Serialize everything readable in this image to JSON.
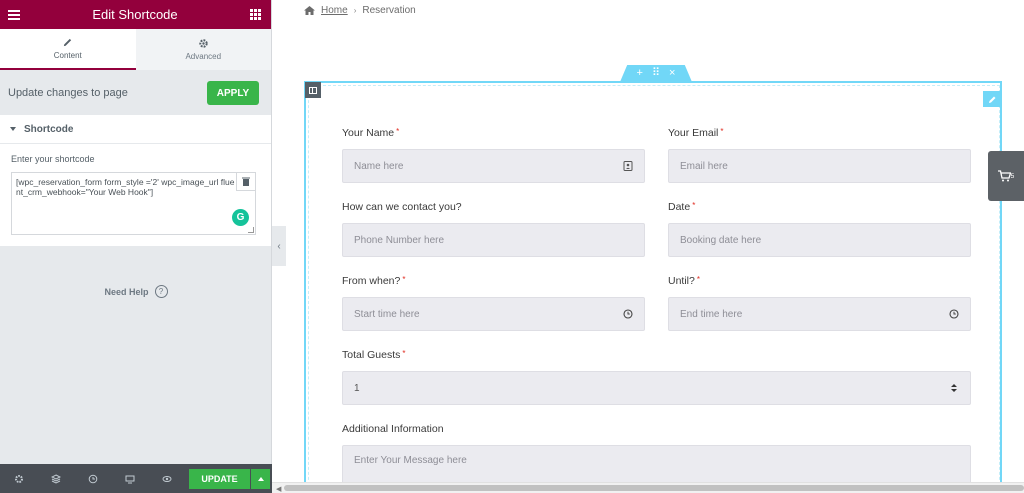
{
  "panel": {
    "title": "Edit Shortcode",
    "tabs": [
      {
        "label": "Content",
        "icon": "pencil-icon"
      },
      {
        "label": "Advanced",
        "icon": "gear-icon"
      }
    ],
    "apply_text": "Update changes to page",
    "apply_label": "APPLY",
    "section_title": "Shortcode",
    "field_label": "Enter your shortcode",
    "shortcode_value": "[wpc_reservation_form form_style ='2' wpc_image_url fluent_crm_webhook=\"Your Web Hook\"]",
    "need_help": "Need Help",
    "footer": {
      "update_label": "UPDATE",
      "icons": [
        "settings-icon",
        "layers-icon",
        "history-icon",
        "responsive-icon",
        "preview-eye-icon"
      ]
    },
    "colors": {
      "header": "#93003c",
      "apply": "#39b54a",
      "footer": "#484d54"
    }
  },
  "preview": {
    "breadcrumb": {
      "home": "Home",
      "current": "Reservation"
    },
    "form": {
      "name": {
        "label": "Your Name",
        "placeholder": "Name here"
      },
      "email": {
        "label": "Your Email",
        "placeholder": "Email here"
      },
      "contact": {
        "label": "How can we contact you?",
        "placeholder": "Phone Number here"
      },
      "date": {
        "label": "Date",
        "placeholder": "Booking date here"
      },
      "from": {
        "label": "From when?",
        "placeholder": "Start time here"
      },
      "until": {
        "label": "Until?",
        "placeholder": "End time here"
      },
      "guests": {
        "label": "Total Guests",
        "value": "1"
      },
      "info": {
        "label": "Additional Information",
        "placeholder": "Enter Your Message here"
      },
      "required_mark": "*"
    },
    "cart_count": "5",
    "section_handle": {
      "add": "+",
      "move": "⠿",
      "close": "×"
    },
    "colors": {
      "frame": "#71d7f7",
      "required": "#e02b20"
    }
  }
}
